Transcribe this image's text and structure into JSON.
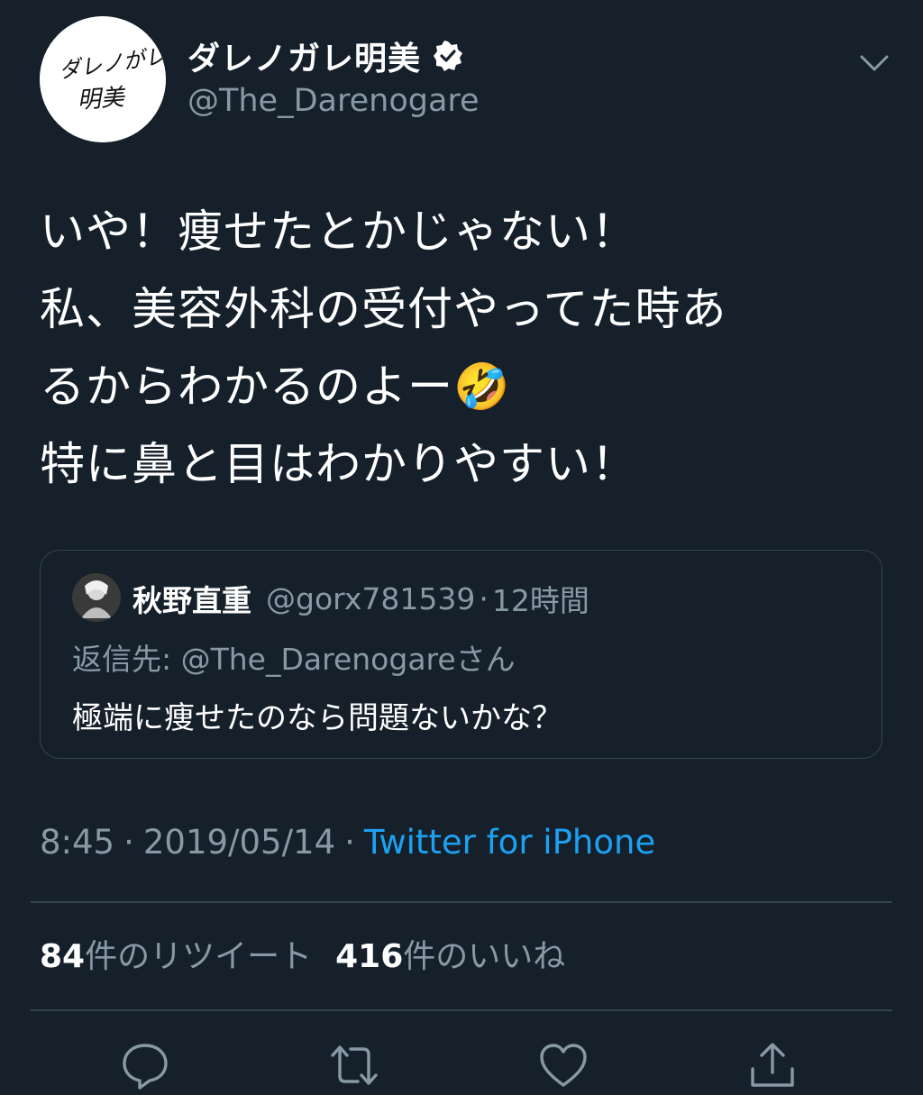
{
  "tweet": {
    "avatar_text": [
      "ダレノがレ",
      "明美"
    ],
    "display_name": "ダレノガレ明美",
    "handle": "@The_Darenogare",
    "text_lines": [
      "いや！痩せたとかじゃない！",
      "私、美容外科の受付やってた時あ",
      "るからわかるのよー🤣",
      "特に鼻と目はわかりやすい！"
    ],
    "time": "8:45",
    "date": "2019/05/14",
    "separator": "·",
    "source": "Twitter for iPhone"
  },
  "quote": {
    "name": "秋野直重",
    "handle": "@gorx781539",
    "separator": "·",
    "time": "12時間",
    "reply_to": "返信先: @The_Darenogareさん",
    "text": "極端に痩せたのなら問題ないかな？"
  },
  "counts": {
    "retweets_num": "84",
    "retweets_label": "件のリツイート",
    "likes_num": "416",
    "likes_label": "件のいいね"
  },
  "icons": {
    "verified": "verified-badge-icon",
    "menu": "chevron-down-icon",
    "reply": "reply-icon",
    "retweet": "retweet-icon",
    "like": "heart-icon",
    "share": "share-icon"
  },
  "colors": {
    "background": "#15202b",
    "text_primary": "#ffffff",
    "text_secondary": "#8899a6",
    "link": "#1da1f2",
    "border": "#38444d"
  }
}
